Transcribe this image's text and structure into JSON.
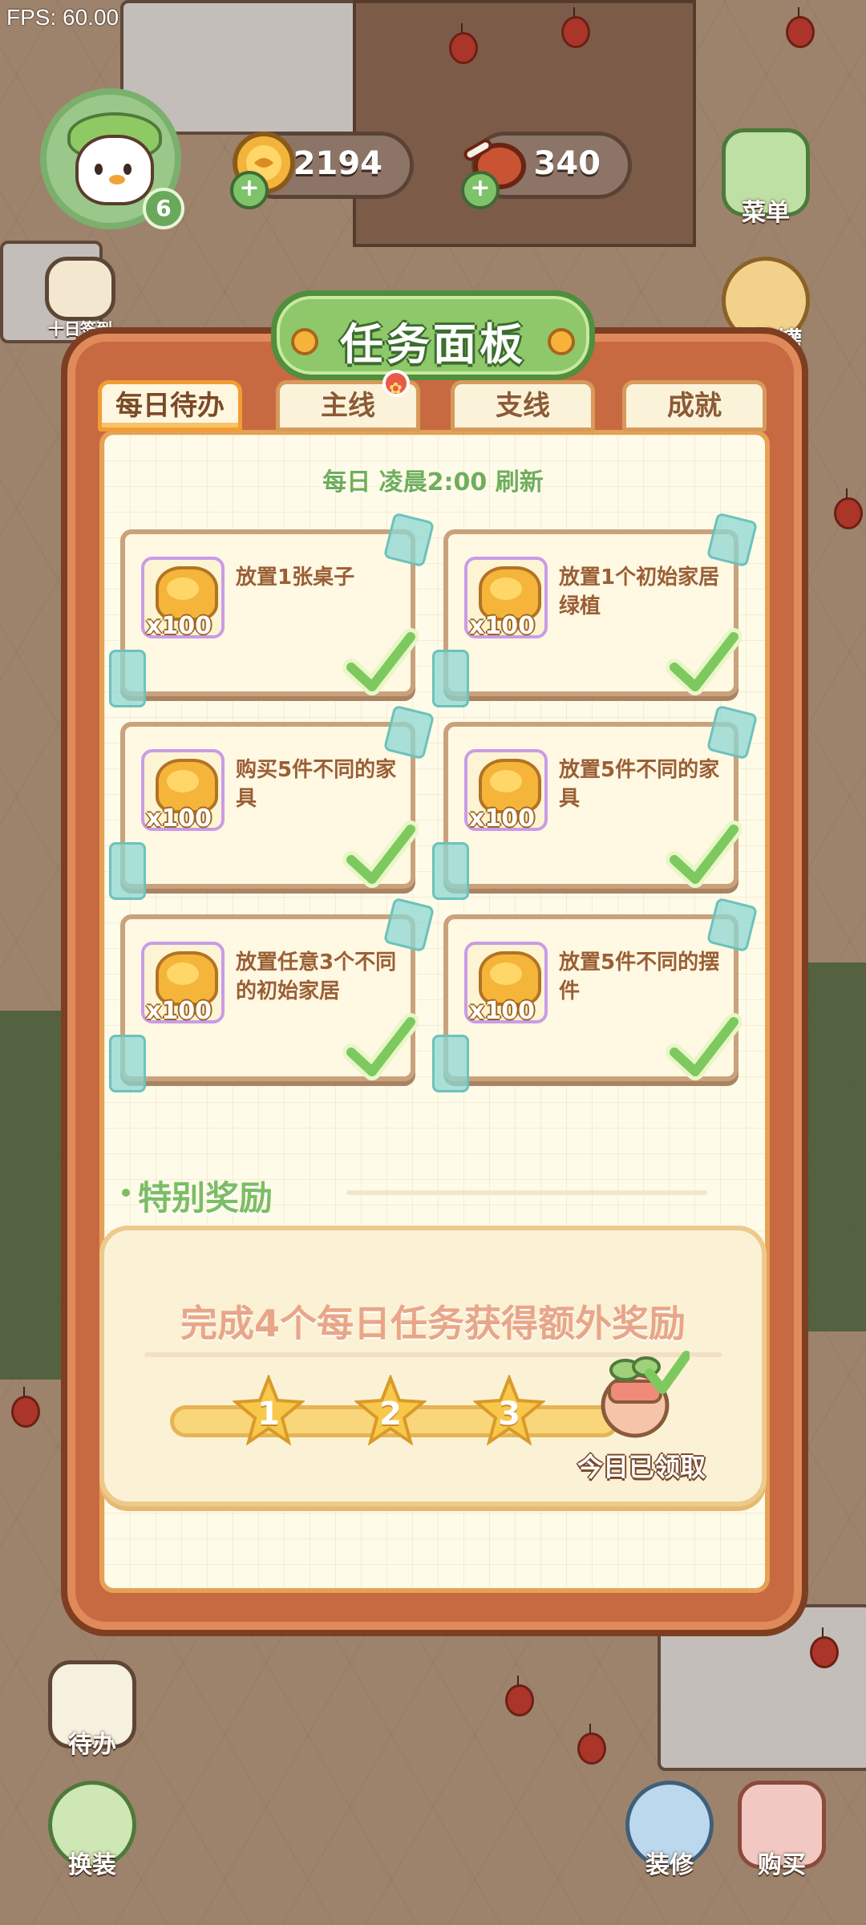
{
  "hud": {
    "fps": "FPS: 60.00",
    "level": "6",
    "coins": "2194",
    "food": "340"
  },
  "side_buttons": {
    "checkin": "十日签到",
    "menu": "菜单",
    "piggy": "存钱罐",
    "todo": "待办",
    "dress": "换装",
    "decorate": "装修",
    "buy": "购买"
  },
  "panel": {
    "title": "任务面板",
    "tabs": [
      {
        "label": "每日待办",
        "active": true
      },
      {
        "label": "主线",
        "badge": true
      },
      {
        "label": "支线"
      },
      {
        "label": "成就"
      }
    ],
    "refresh": "每日 凌晨2:00 刷新",
    "tasks": [
      {
        "desc": "放置1张桌子",
        "reward": "x100",
        "done": true
      },
      {
        "desc": "放置1个初始家居绿植",
        "reward": "x100",
        "done": true
      },
      {
        "desc": "购买5件不同的家具",
        "reward": "x100",
        "done": true
      },
      {
        "desc": "放置5件不同的家具",
        "reward": "x100",
        "done": true
      },
      {
        "desc": "放置任意3个不同的初始家居",
        "reward": "x100",
        "done": true
      },
      {
        "desc": "放置5件不同的摆件",
        "reward": "x100",
        "done": true
      }
    ],
    "special_title": "特别奖励",
    "bonus_text": "完成4个每日任务获得额外奖励",
    "milestones": [
      "1",
      "2",
      "3"
    ],
    "claimed": "今日已领取"
  },
  "colors": {
    "panel_frame": "#c76a42",
    "title_green": "#8fc86a",
    "check_green": "#7ec95f",
    "paper": "#fffbe9"
  }
}
